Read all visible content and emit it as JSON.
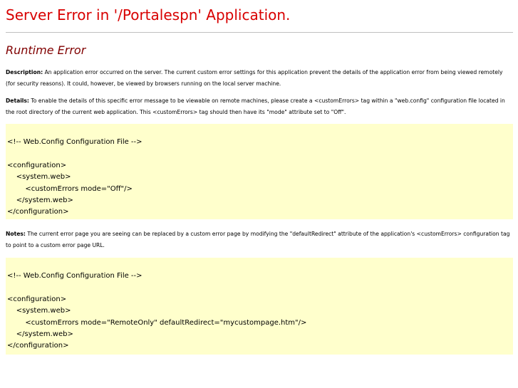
{
  "page": {
    "title": "Server Error in '/Portalespn' Application.",
    "subtitle": "Runtime Error"
  },
  "description": {
    "label": "Description:",
    "text": " An application error occurred on the server. The current custom error settings for this application prevent the details of the application error from being viewed remotely (for security reasons). It could, however, be viewed by browsers running on the local server machine."
  },
  "details": {
    "label": "Details:",
    "text": " To enable the details of this specific error message to be viewable on remote machines, please create a <customErrors> tag within a \"web.config\" configuration file located in the root directory of the current web application. This <customErrors> tag should then have its \"mode\" attribute set to \"Off\"."
  },
  "code_block_1": {
    "lines": [
      "<!-- Web.Config Configuration File -->",
      "",
      "<configuration>",
      "    <system.web>",
      "        <customErrors mode=\"Off\"/>",
      "    </system.web>",
      "</configuration>"
    ]
  },
  "notes": {
    "label": "Notes:",
    "text": " The current error page you are seeing can be replaced by a custom error page by modifying the \"defaultRedirect\" attribute of the application's <customErrors> configuration tag to point to a custom error page URL."
  },
  "code_block_2": {
    "lines": [
      "<!-- Web.Config Configuration File -->",
      "",
      "<configuration>",
      "    <system.web>",
      "        <customErrors mode=\"RemoteOnly\" defaultRedirect=\"mycustompage.htm\"/>",
      "    </system.web>",
      "</configuration>"
    ]
  },
  "colors": {
    "title": "#d80000",
    "subtitle": "#800000",
    "code_background": "#ffffcc",
    "rule": "#c0c0c0"
  }
}
